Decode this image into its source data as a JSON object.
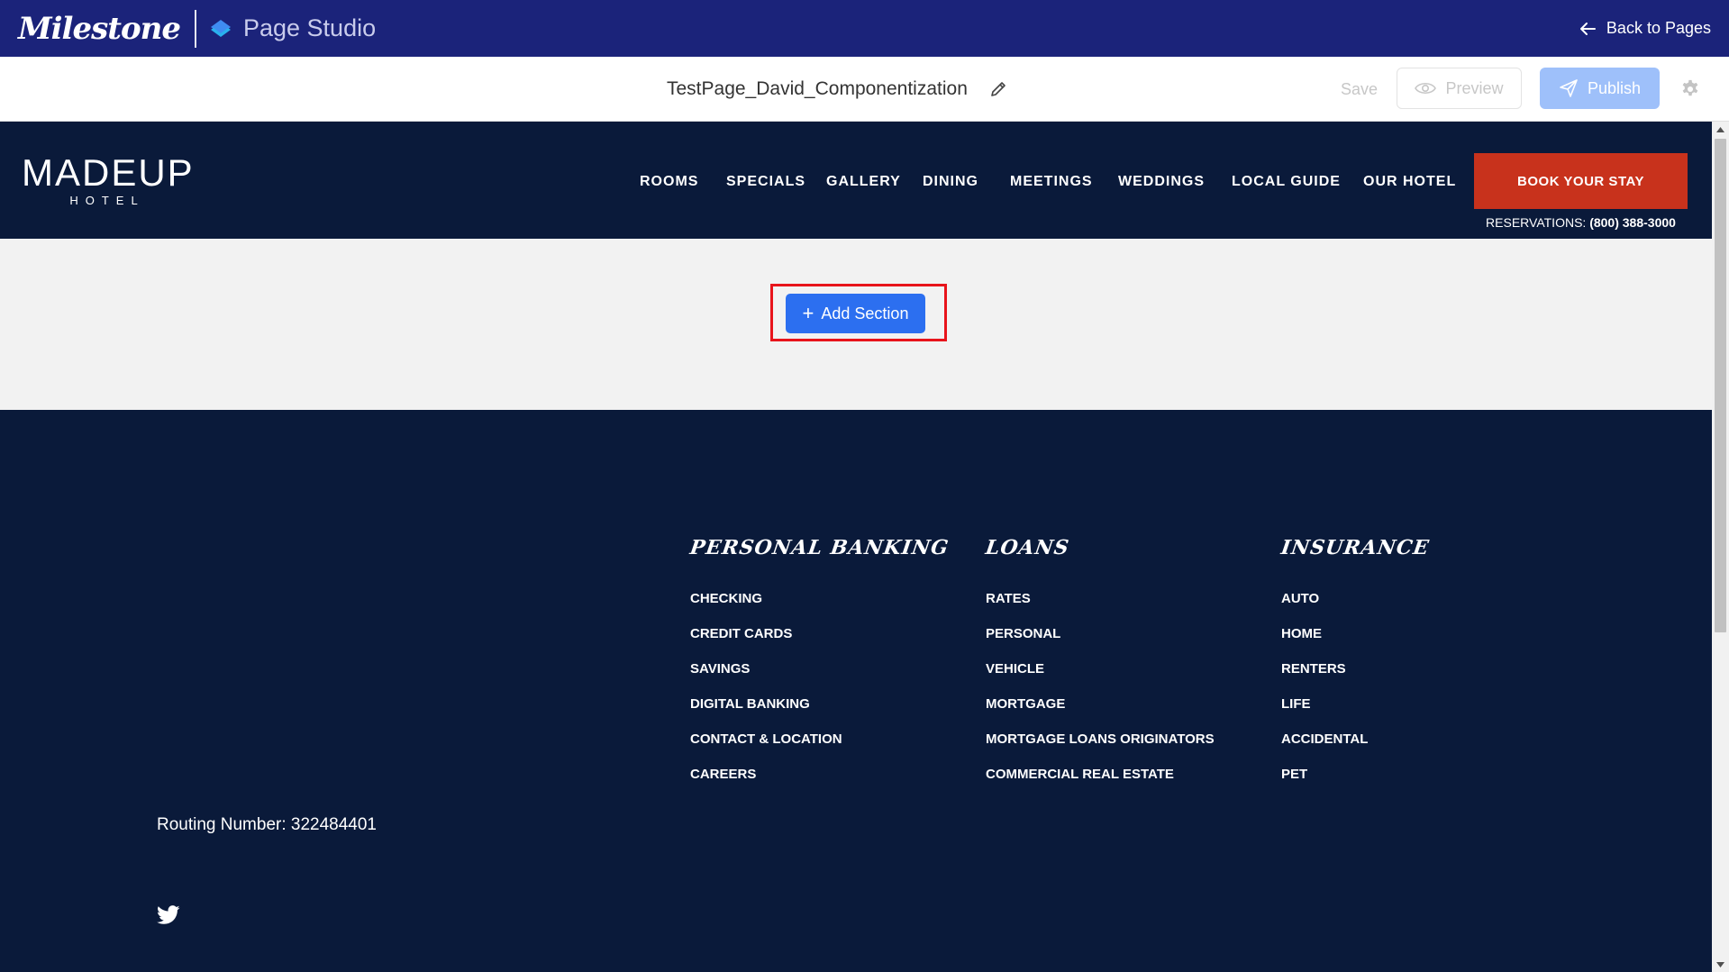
{
  "appbar": {
    "brand": "Milestone",
    "product": "Page Studio",
    "back_label": "Back to Pages"
  },
  "toolbar": {
    "page_title": "TestPage_David_Componentization",
    "save_label": "Save",
    "preview_label": "Preview",
    "publish_label": "Publish"
  },
  "site_header": {
    "logo_main": "MADEUP",
    "logo_sub": "HOTEL",
    "nav": [
      "ROOMS",
      "SPECIALS",
      "GALLERY",
      "DINING",
      "MEETINGS",
      "WEDDINGS",
      "LOCAL GUIDE",
      "OUR HOTEL"
    ],
    "book_label": "BOOK YOUR STAY",
    "reservations_label": "RESERVATIONS:",
    "reservations_phone": "(800) 388-3000"
  },
  "add_section": {
    "label": "Add Section"
  },
  "footer": {
    "columns": [
      {
        "heading": "PERSONAL BANKING",
        "links": [
          "CHECKING",
          "CREDIT CARDS",
          "SAVINGS",
          "DIGITAL BANKING",
          "CONTACT & LOCATION",
          "CAREERS"
        ]
      },
      {
        "heading": "LOANS",
        "links": [
          "RATES",
          "PERSONAL",
          "VEHICLE",
          "MORTGAGE",
          "MORTGAGE LOANS ORIGINATORS",
          "COMMERCIAL REAL ESTATE"
        ]
      },
      {
        "heading": "INSURANCE",
        "links": [
          "AUTO",
          "HOME",
          "RENTERS",
          "LIFE",
          "ACCIDENTAL",
          "PET"
        ]
      }
    ],
    "routing": "Routing Number: 322484401"
  },
  "colors": {
    "appbar": "#1b237a",
    "site_navy": "#0a1a3a",
    "book_button": "#c8321c",
    "add_button": "#2c6ff0",
    "publish_button": "#9ec0fa",
    "highlight": "#e8141b"
  },
  "icons": {
    "studio": "layers-diamond-icon",
    "back": "arrow-left-icon",
    "edit": "pencil-icon",
    "preview": "eye-icon",
    "publish": "paper-plane-icon",
    "settings": "gear-icon",
    "social": "twitter-icon"
  }
}
